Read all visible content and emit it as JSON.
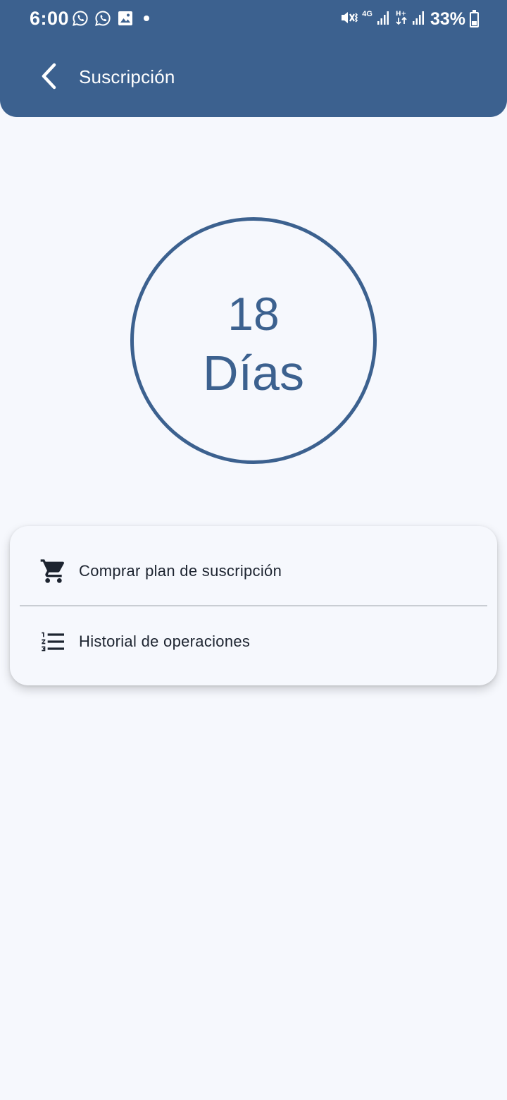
{
  "status_bar": {
    "time": "6:00",
    "network_label": "4G",
    "network_label_2": "H+",
    "battery_percent": "33%",
    "icons": [
      "whatsapp-icon",
      "whatsapp-icon",
      "gallery-icon",
      "dot-icon",
      "mute-vibrate-icon",
      "signal-icon",
      "data-arrows-icon",
      "signal-icon",
      "battery-icon"
    ]
  },
  "appbar": {
    "title": "Suscripción",
    "back_icon": "chevron-left-icon"
  },
  "subscription": {
    "days_remaining": "18",
    "days_label": "Días"
  },
  "menu": {
    "items": [
      {
        "label": "Comprar plan de suscripción",
        "icon": "shopping-cart-icon"
      },
      {
        "label": "Historial de operaciones",
        "icon": "numbered-list-icon"
      }
    ]
  },
  "colors": {
    "primary": "#3c618f",
    "background": "#f6f8fd",
    "text": "#1d2430",
    "divider": "#c9cdd3"
  }
}
